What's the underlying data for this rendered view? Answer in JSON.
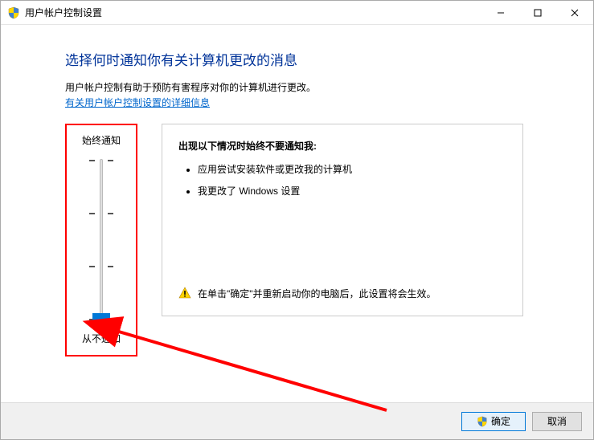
{
  "window": {
    "title": "用户帐户控制设置"
  },
  "heading": "选择何时通知你有关计算机更改的消息",
  "subtext": "用户帐户控制有助于预防有害程序对你的计算机进行更改。",
  "link_text": "有关用户帐户控制设置的详细信息",
  "slider": {
    "top_label": "始终通知",
    "bottom_label": "从不通知",
    "levels": 4,
    "current_level": 0
  },
  "info_panel": {
    "title": "出现以下情况时始终不要通知我:",
    "items": [
      "应用尝试安装软件或更改我的计算机",
      "我更改了 Windows 设置"
    ],
    "warning": "在单击\"确定\"并重新启动你的电脑后，此设置将会生效。"
  },
  "buttons": {
    "ok": "确定",
    "cancel": "取消"
  }
}
